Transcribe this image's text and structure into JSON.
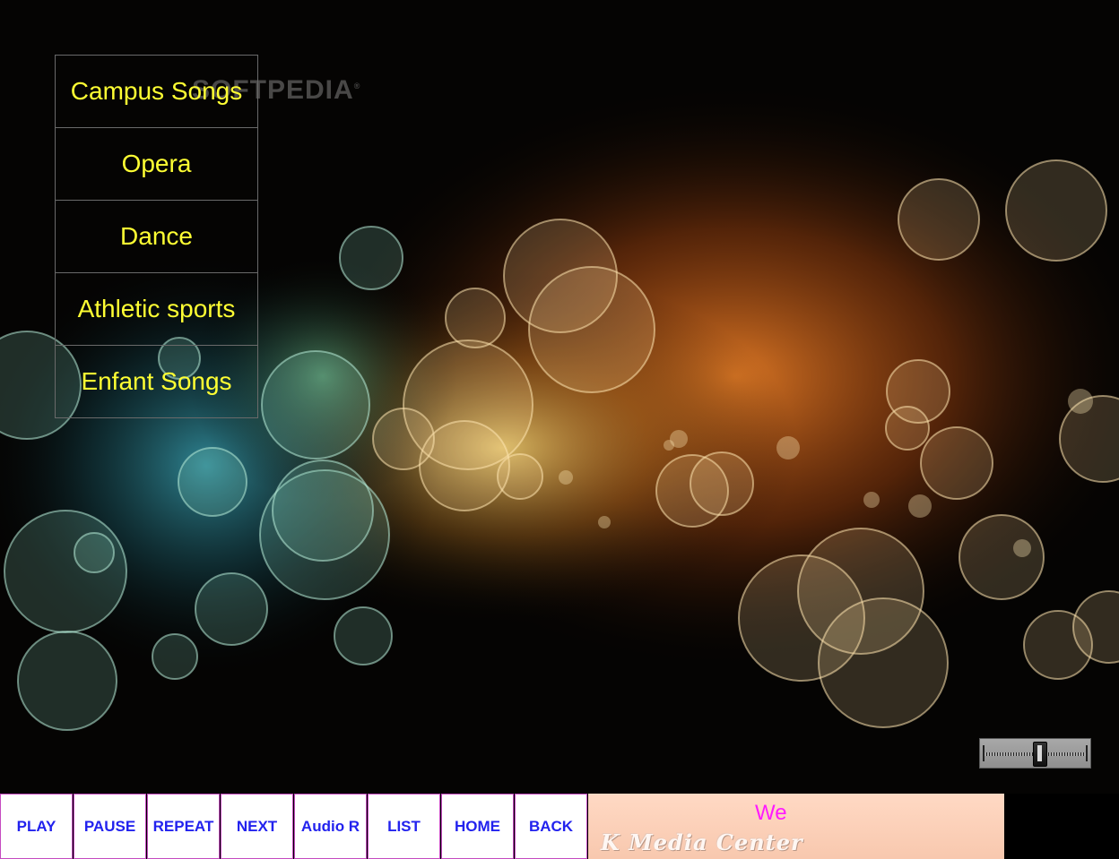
{
  "watermark": {
    "text": "SOFTPEDIA",
    "mark": "®"
  },
  "menu": {
    "items": [
      {
        "label": "Campus Songs"
      },
      {
        "label": "Opera"
      },
      {
        "label": "Dance"
      },
      {
        "label": "Athletic sports"
      },
      {
        "label": "Enfant Songs"
      }
    ]
  },
  "volume": {
    "icon": "volume-slider",
    "level": 0.55
  },
  "toolbar": {
    "buttons": [
      {
        "label": "PLAY"
      },
      {
        "label": "PAUSE"
      },
      {
        "label": "REPEAT"
      },
      {
        "label": "NEXT"
      },
      {
        "label": "Audio R"
      },
      {
        "label": "LIST"
      },
      {
        "label": "HOME"
      },
      {
        "label": "BACK"
      }
    ],
    "marquee_text": "We",
    "logo_text": "K Media Center"
  },
  "colors": {
    "menu_text": "#ffff33",
    "button_text": "#2222ee",
    "button_border": "#c54ac0",
    "marquee_text": "#ff1aff",
    "marquee_bg": "#ffd9c4"
  }
}
